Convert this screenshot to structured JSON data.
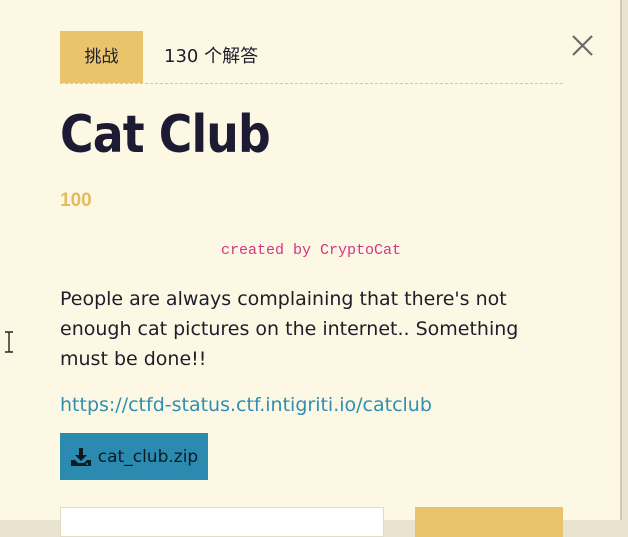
{
  "header": {
    "challenge_tab": "挑战",
    "solves_tab": "130 个解答"
  },
  "challenge": {
    "title": "Cat Club",
    "points": "100",
    "author": "created by CryptoCat",
    "description": "People are always complaining that there's not enough cat pictures on the internet.. Something must be done!!",
    "link": "https://ctfd-status.ctf.intigriti.io/catclub",
    "file_label": "cat_club.zip"
  },
  "icons": {
    "close": "close-icon",
    "download": "download-icon",
    "cursor": "text-cursor-icon"
  },
  "colors": {
    "accent": "#e9c46a",
    "link": "#2d8fb5",
    "file_button": "#2a8ab0",
    "author": "#d63384",
    "background": "#fcf8e3"
  }
}
